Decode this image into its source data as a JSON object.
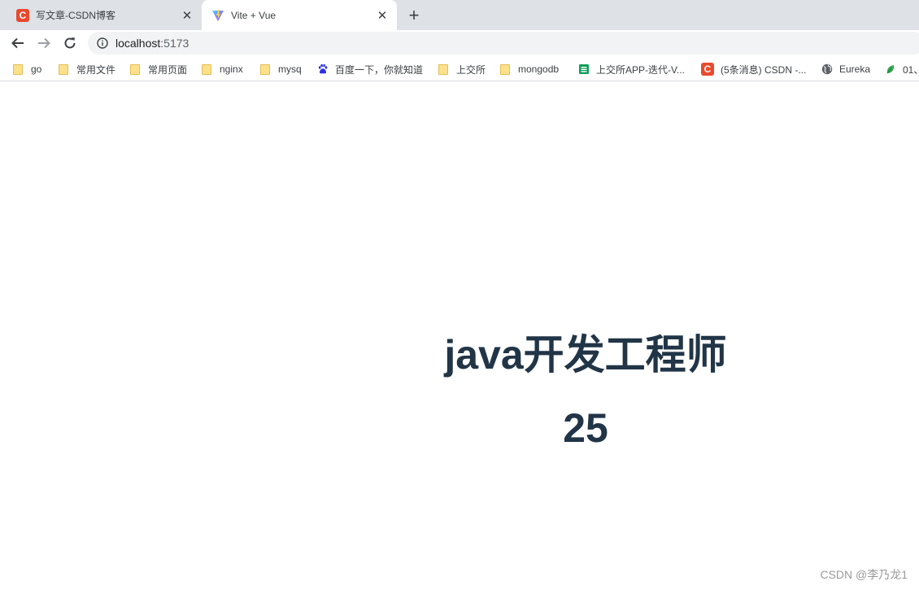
{
  "tabs": [
    {
      "title": "写文章-CSDN博客",
      "favicon": "csdn-icon",
      "favicon_text": "C"
    },
    {
      "title": "Vite + Vue",
      "favicon": "vite-icon"
    }
  ],
  "toolbar": {
    "url_host": "localhost",
    "url_port": ":5173"
  },
  "bookmarks": [
    {
      "label": "go",
      "icon": "folder-icon"
    },
    {
      "label": "常用文件",
      "icon": "folder-icon"
    },
    {
      "label": "常用页面",
      "icon": "folder-icon"
    },
    {
      "label": "nginx",
      "icon": "folder-icon"
    },
    {
      "label": "mysq",
      "icon": "folder-icon"
    },
    {
      "label": "百度一下，你就知道",
      "icon": "baidu-paw-icon"
    },
    {
      "label": "上交所",
      "icon": "folder-icon"
    },
    {
      "label": "mongodb",
      "icon": "folder-icon"
    },
    {
      "label": "上交所APP-迭代-V...",
      "icon": "sheets-icon"
    },
    {
      "label": "(5条消息) CSDN -...",
      "icon": "csdn-icon",
      "icon_text": "C"
    },
    {
      "label": "Eureka",
      "icon": "globe-icon"
    },
    {
      "label": "01、",
      "icon": "leaf-icon"
    }
  ],
  "page": {
    "headline": "java开发工程师",
    "age": "25"
  },
  "watermark": "CSDN @李乃龙1",
  "colors": {
    "text": "#213547",
    "tabstrip": "#dee1e6",
    "omnibox": "#f1f3f4",
    "csdn": "#e84a2e",
    "folder": "#fce08a"
  }
}
